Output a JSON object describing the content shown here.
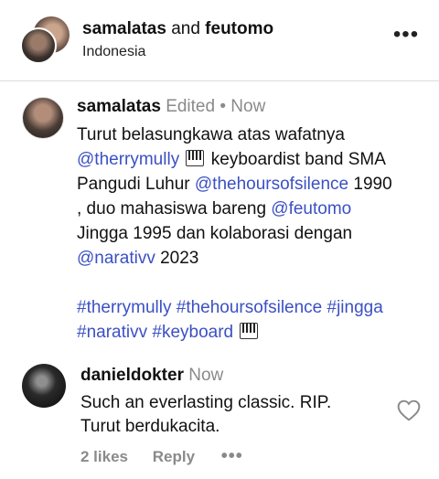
{
  "header": {
    "user1": "samalatas",
    "joiner": "and",
    "user2": "feutomo",
    "location": "Indonesia",
    "more_icon": "more-horizontal-icon"
  },
  "post": {
    "username": "samalatas",
    "edited": "Edited",
    "separator": "•",
    "time": "Now",
    "line1": "Turut belasungkawa atas wafatnya",
    "mention1": "@therrymully",
    "line2_rest": " keyboardist band SMA",
    "line3_a": "Pangudi Luhur ",
    "mention2": "@thehoursofsilence",
    "line3_b": " 1990",
    "line4_a": ", duo mahasiswa bareng ",
    "mention3": "@feutomo",
    "line5": "Jingga 1995 dan kolaborasi dengan",
    "mention4": "@narativv",
    "line6_b": " 2023",
    "hashtags1": "#therrymully #thehoursofsilence #jingga",
    "hashtags2": "#narativv #keyboard",
    "emoji_icon": "piano-keyboard-icon"
  },
  "reply": {
    "username": "danieldokter",
    "time": "Now",
    "line1": "Such an everlasting classic. RIP.",
    "line2": "Turut berdukacita.",
    "likes": "2 likes",
    "reply_label": "Reply",
    "more": "•••"
  },
  "colors": {
    "link": "#3b50c4",
    "muted": "#8a8a8a",
    "divider": "#dcdcdc"
  }
}
